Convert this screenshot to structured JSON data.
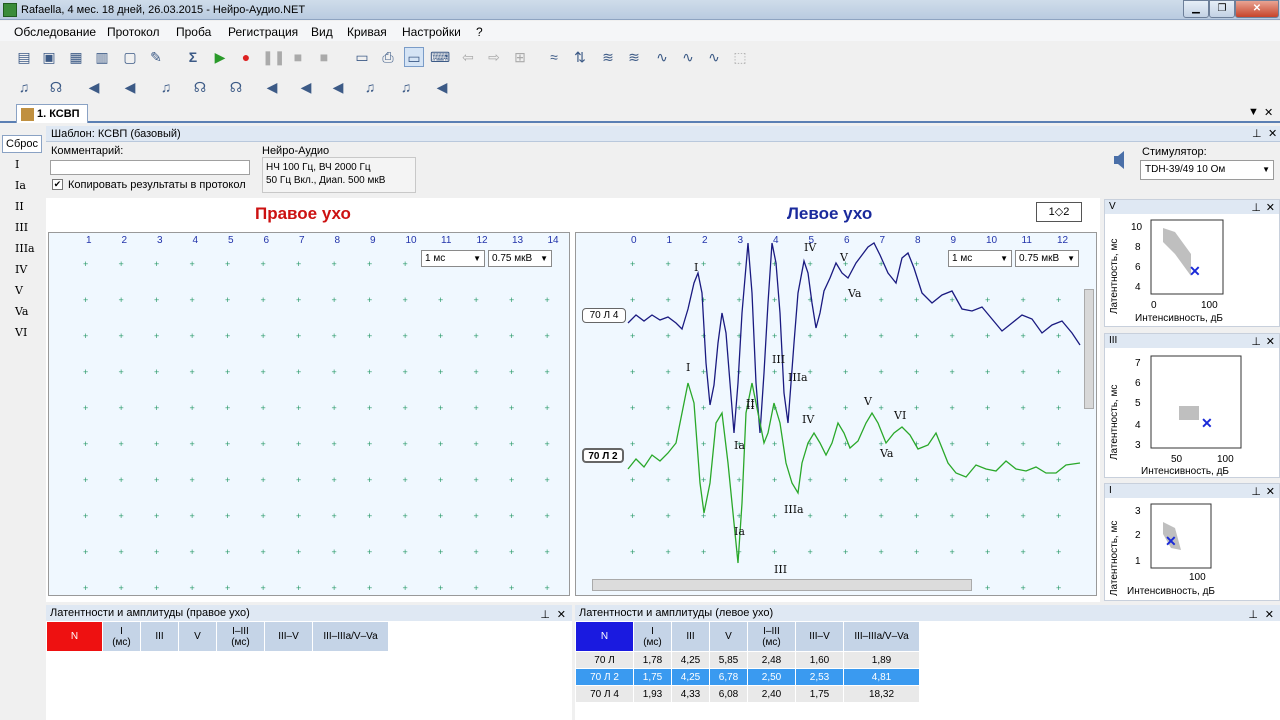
{
  "window": {
    "title": "Rafaella,  4 мес. 18 дней, 26.03.2015 - Нейро-Аудио.NET",
    "minimize": "▁",
    "maximize": "❐",
    "close": "✕"
  },
  "menu": [
    "Обследование",
    "Протокол",
    "Проба",
    "Регистрация",
    "Вид",
    "Кривая",
    "Настройки",
    "?"
  ],
  "toolbar_icons": [
    "new-icon",
    "open-icon",
    "save-icon",
    "export-icon",
    "new-doc-icon",
    "tools-icon",
    "sigma-icon",
    "play-icon",
    "record-icon",
    "pause-icon",
    "stop-icon",
    "stop-save-icon",
    "print-preview-icon",
    "print-icon",
    "monitor-icon",
    "keyboard-icon",
    "arrow-left-icon",
    "arrow-right-icon",
    "grid-icon",
    "curve-edit-icon",
    "split-icon",
    "wave-1-icon",
    "wave-2-icon",
    "wave-3-icon",
    "wave-4-icon",
    "wave-5-icon",
    "select-icon"
  ],
  "tab": {
    "label": "1. КСВП"
  },
  "sidebar": {
    "reset": "Сброс",
    "waves": [
      "I",
      "Ia",
      "II",
      "III",
      "IIIa",
      "IV",
      "V",
      "Va",
      "VI"
    ]
  },
  "panel": {
    "title": "Шаблон: КСВП (базовый)"
  },
  "form": {
    "comment_label": "Комментарий:",
    "comment_value": "",
    "copy_label": "Копировать результаты в протокол",
    "copy_checked": true,
    "device_label": "Нейро-Аудио",
    "device_line1": "НЧ  100 Гц, ВЧ  2000 Гц",
    "device_line2": "50 Гц  Вкл., Диап. 500 мкВ",
    "stim_label": "Стимулятор:",
    "stim_value": "TDH-39/49 10 Ом"
  },
  "right_ear": {
    "title": "Правое ухо",
    "color": "#cc1111",
    "ticks": [
      "1",
      "2",
      "3",
      "4",
      "5",
      "6",
      "7",
      "8",
      "9",
      "10",
      "11",
      "12",
      "13",
      "14"
    ],
    "time_scale": "1 мс",
    "amp_scale": "0.75 мкВ"
  },
  "left_ear": {
    "title": "Левое ухо",
    "color": "#1a2a9c",
    "ticks": [
      "0",
      "1",
      "2",
      "3",
      "4",
      "5",
      "6",
      "7",
      "8",
      "9",
      "10",
      "11",
      "12"
    ],
    "time_scale": "1 мс",
    "amp_scale": "0.75 мкВ"
  },
  "swap_button": "1◇2",
  "traces": [
    {
      "label": "70 Л 4",
      "color": "#1a1a80",
      "peaks": [
        "I",
        "Ia",
        "II",
        "III",
        "IIIa",
        "IV",
        "V",
        "Va"
      ]
    },
    {
      "label": "70 Л 2",
      "color": "#2aa82a",
      "peaks": [
        "I",
        "Ia",
        "II",
        "III",
        "IIIa",
        "IV",
        "V",
        "Va",
        "VI"
      ]
    }
  ],
  "right_panels": [
    {
      "title": "V",
      "ylabel": "Латентность, мс",
      "xlabel": "Интенсивность, дБ",
      "yticks": [
        "10",
        "8",
        "6",
        "4"
      ],
      "xticks": [
        "0",
        "100"
      ]
    },
    {
      "title": "III",
      "ylabel": "Латентность, мс",
      "xlabel": "Интенсивность, дБ",
      "yticks": [
        "7",
        "6",
        "5",
        "4",
        "3"
      ],
      "xticks": [
        "50",
        "100"
      ]
    },
    {
      "title": "I",
      "ylabel": "Латентность, мс",
      "xlabel": "Интенсивность, дБ",
      "yticks": [
        "3",
        "2",
        "1"
      ],
      "xticks": [
        "100"
      ]
    }
  ],
  "table_right": {
    "title": "Латентности и амплитуды (правое ухо)",
    "headers": [
      "N",
      "I\n(мс)",
      "III",
      "V",
      "I–III\n(мс)",
      "III–V",
      "III–IIIa/V–Va"
    ],
    "rows": []
  },
  "table_left": {
    "title": "Латентности и амплитуды (левое ухо)",
    "headers": [
      "N",
      "I\n(мс)",
      "III",
      "V",
      "I–III\n(мс)",
      "III–V",
      "III–IIIa/V–Va"
    ],
    "rows": [
      [
        "70 Л",
        "1,78",
        "4,25",
        "5,85",
        "2,48",
        "1,60",
        "1,89"
      ],
      [
        "70 Л 2",
        "1,75",
        "4,25",
        "6,78",
        "2,50",
        "2,53",
        "4,81"
      ],
      [
        "70 Л 4",
        "1,93",
        "4,33",
        "6,08",
        "2,40",
        "1,75",
        "18,32"
      ]
    ],
    "selected_row": 1
  }
}
